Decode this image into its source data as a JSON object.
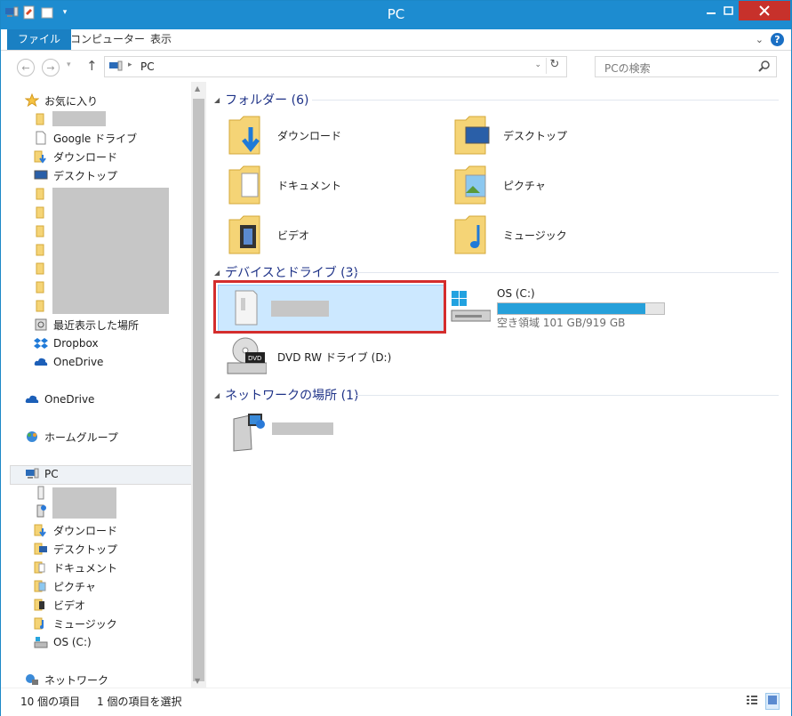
{
  "window": {
    "title": "PC"
  },
  "ribbon": {
    "tabs": [
      "ファイル",
      "コンピューター",
      "表示"
    ]
  },
  "address": {
    "path": "PC",
    "search_placeholder": "PCの検索"
  },
  "sidebar": {
    "favorites_label": "お気に入り",
    "favorites": [
      "Google ドライブ",
      "ダウンロード",
      "デスクトップ",
      "最近表示した場所",
      "Dropbox",
      "OneDrive"
    ],
    "onedrive": "OneDrive",
    "homegroup": "ホームグループ",
    "pc": "PC",
    "pc_items": [
      "ダウンロード",
      "デスクトップ",
      "ドキュメント",
      "ピクチャ",
      "ビデオ",
      "ミュージック",
      "OS (C:)"
    ],
    "network": "ネットワーク"
  },
  "main": {
    "folders_header": "フォルダー (6)",
    "folders": [
      "ダウンロード",
      "デスクトップ",
      "ドキュメント",
      "ピクチャ",
      "ビデオ",
      "ミュージック"
    ],
    "devices_header": "デバイスとドライブ (3)",
    "os_drive": {
      "name": "OS (C:)",
      "free_text": "空き領域 101 GB/919 GB",
      "used_fraction": 0.89
    },
    "dvd_drive": "DVD RW ドライブ (D:)",
    "network_header": "ネットワークの場所 (1)"
  },
  "status": {
    "items": "10 個の項目",
    "selected": "1 個の項目を選択"
  }
}
